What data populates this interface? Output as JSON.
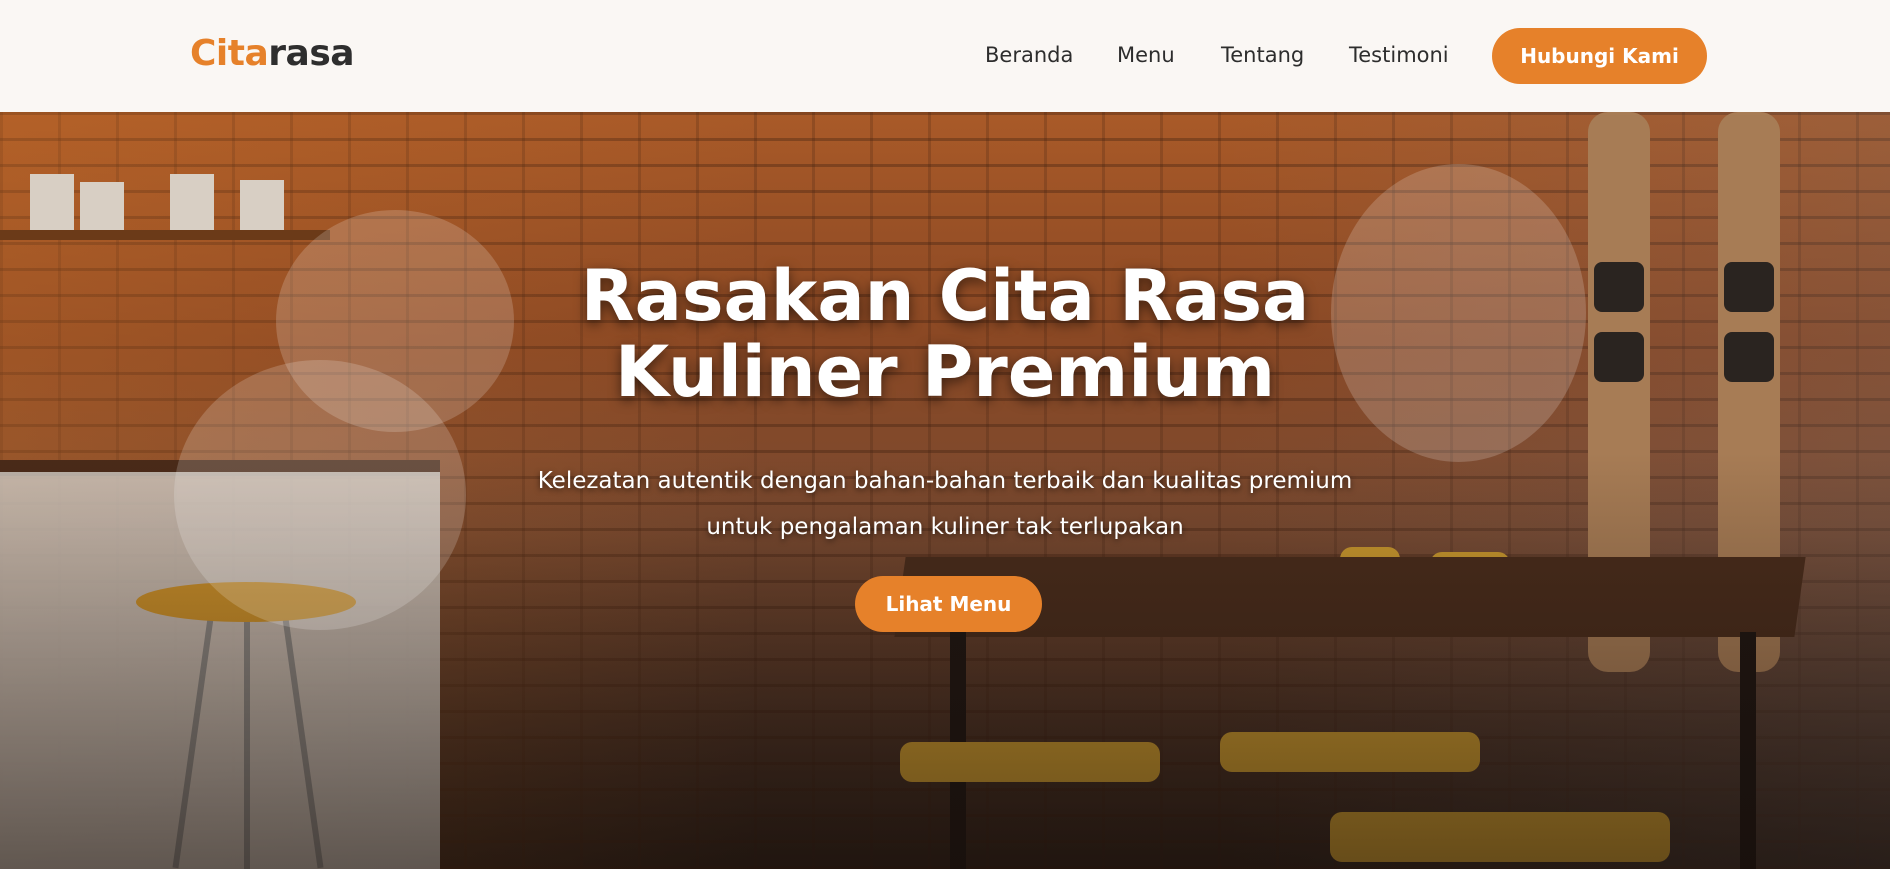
{
  "brand": {
    "part1": "Cita",
    "part2": "rasa",
    "accent_color": "#e6812a",
    "dark_color": "#2e2e2e"
  },
  "nav": {
    "links": [
      {
        "label": "Beranda"
      },
      {
        "label": "Menu"
      },
      {
        "label": "Tentang"
      },
      {
        "label": "Testimoni"
      }
    ],
    "cta_label": "Hubungi Kami"
  },
  "hero": {
    "title_line1": "Rasakan Cita Rasa",
    "title_line2": "Kuliner Premium",
    "subtitle_line1": "Kelezatan autentik dengan bahan-bahan terbaik dan kualitas premium",
    "subtitle_line2": "untuk pengalaman kuliner tak terlupakan",
    "cta_label": "Lihat Menu"
  }
}
